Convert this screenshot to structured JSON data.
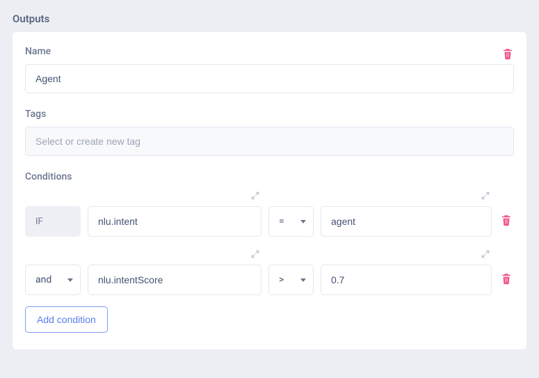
{
  "section_title": "Outputs",
  "name": {
    "label": "Name",
    "value": "Agent"
  },
  "tags": {
    "label": "Tags",
    "placeholder": "Select or create new tag"
  },
  "conditions": {
    "label": "Conditions",
    "rows": [
      {
        "logical": "IF",
        "logical_fixed": true,
        "field": "nlu.intent",
        "op": "=",
        "value": "agent"
      },
      {
        "logical": "and",
        "logical_fixed": false,
        "field": "nlu.intentScore",
        "op": ">",
        "value": "0.7"
      }
    ],
    "add_label": "Add condition"
  },
  "icons": {
    "trash": "trash-icon",
    "expand": "expand-icon",
    "caret": "caret-down-icon"
  },
  "colors": {
    "accent_danger": "#f15586",
    "accent_link": "#5a7df0",
    "panel_bg": "#ffffff",
    "page_bg": "#eceef3",
    "border": "#e4e7ef"
  }
}
